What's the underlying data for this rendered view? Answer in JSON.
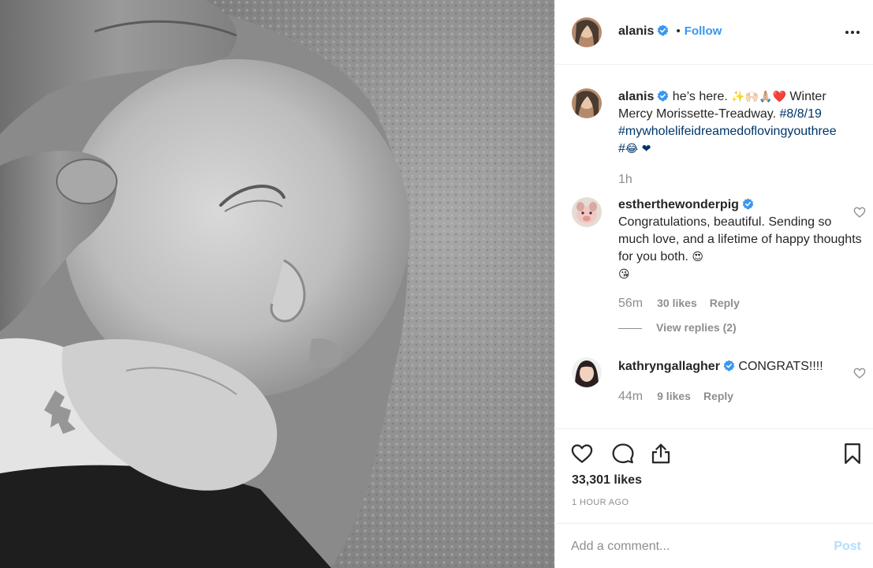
{
  "header": {
    "username": "alanis",
    "bullet": "•",
    "follow_label": "Follow"
  },
  "caption": {
    "username": "alanis",
    "text_part1": " he’s here. ",
    "emoji_line": "✨🙌🏻🙏🏼❤️",
    "text_part2": " Winter Mercy Morissette-Treadway. ",
    "tag_date": "#8/8/19",
    "tag_long": "#mywholelifeidreamedoflovingyouthree",
    "tag_hash": "#",
    "tag_emoji": "😂",
    "heart_emoji": "❤",
    "time": "1h"
  },
  "comments": [
    {
      "username": "estherthewonderpig",
      "text": "Congratulations, beautiful. Sending so much love, and a lifetime of happy thoughts for you both.",
      "emoji_inline": "😍",
      "emoji_newline": "😘",
      "time": "56m",
      "likes": "30 likes",
      "reply": "Reply",
      "view_replies": "View replies (2)"
    },
    {
      "username": "kathryngallagher",
      "text": "CONGRATS!!!!",
      "time": "44m",
      "likes": "9 likes",
      "reply": "Reply"
    }
  ],
  "actions": {
    "icons": [
      "heart-icon",
      "comment-icon",
      "share-icon",
      "bookmark-icon"
    ],
    "likes_count": "33,301 likes",
    "time_ago": "1 HOUR AGO"
  },
  "add_comment": {
    "placeholder": "Add a comment...",
    "post_label": "Post"
  },
  "colors": {
    "link": "#3897f0",
    "hashtag": "#003569",
    "muted": "#8e8e8e",
    "post_disabled": "#b2dffc"
  }
}
